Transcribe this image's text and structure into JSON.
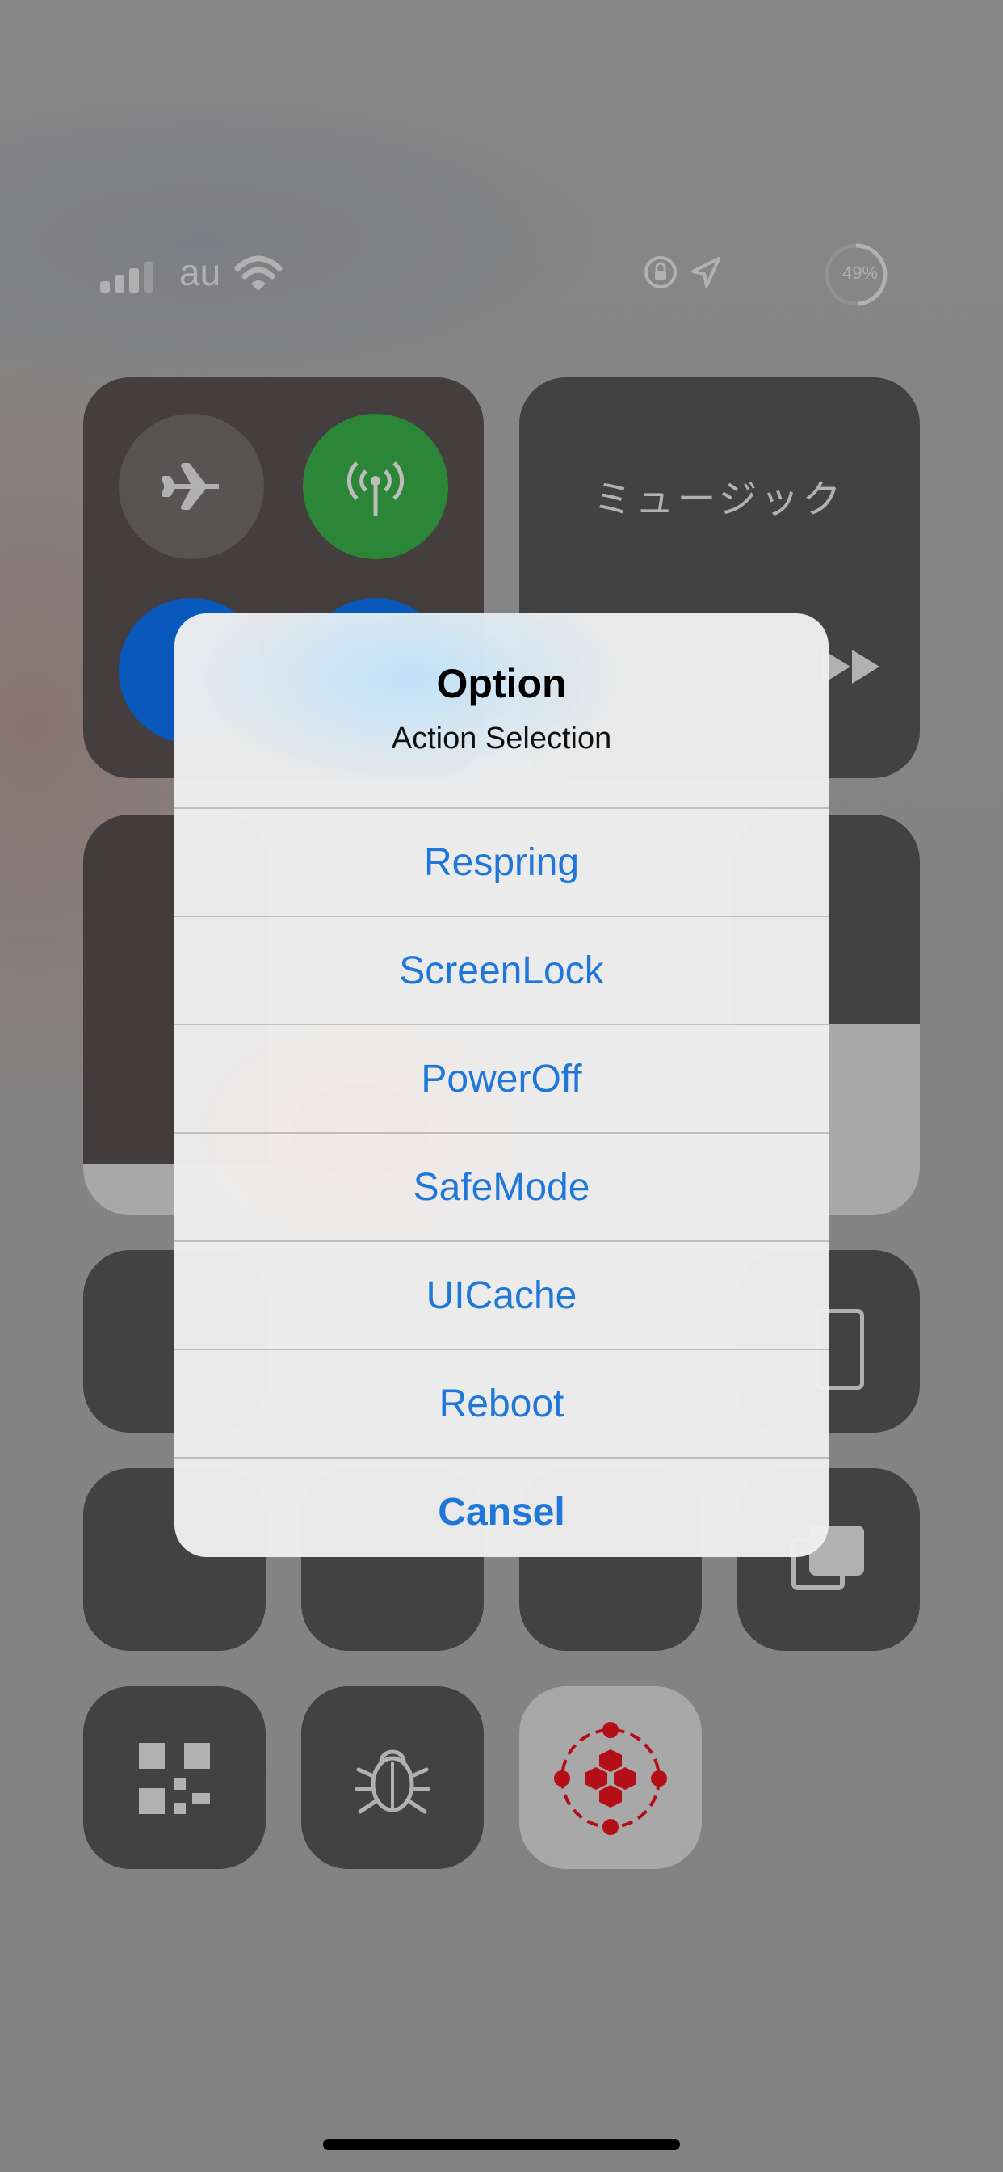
{
  "status_bar": {
    "carrier": "au",
    "battery_percent": "49%",
    "battery_level": 0.49
  },
  "control_center": {
    "music_label": "ミュージック",
    "toggles": [
      "airplane-mode",
      "cellular-data",
      "wifi",
      "bluetooth"
    ],
    "bottom_buttons": [
      "flashlight",
      "timer",
      "calculator",
      "notes",
      "camera",
      "alarm",
      "screen-mirroring",
      "qr-code",
      "bug",
      "tweak-toggle"
    ]
  },
  "alert": {
    "title": "Option",
    "message": "Action Selection",
    "actions": [
      {
        "label": "Respring"
      },
      {
        "label": "ScreenLock"
      },
      {
        "label": "PowerOff"
      },
      {
        "label": "SafeMode"
      },
      {
        "label": "UICache"
      },
      {
        "label": "Reboot"
      },
      {
        "label": "Cansel"
      }
    ]
  },
  "colors": {
    "action_blue": "#1f78d9",
    "cellular_green": "#2f8f3c",
    "accent_blue": "#0a5fc9",
    "tweak_red": "#c0101a"
  }
}
